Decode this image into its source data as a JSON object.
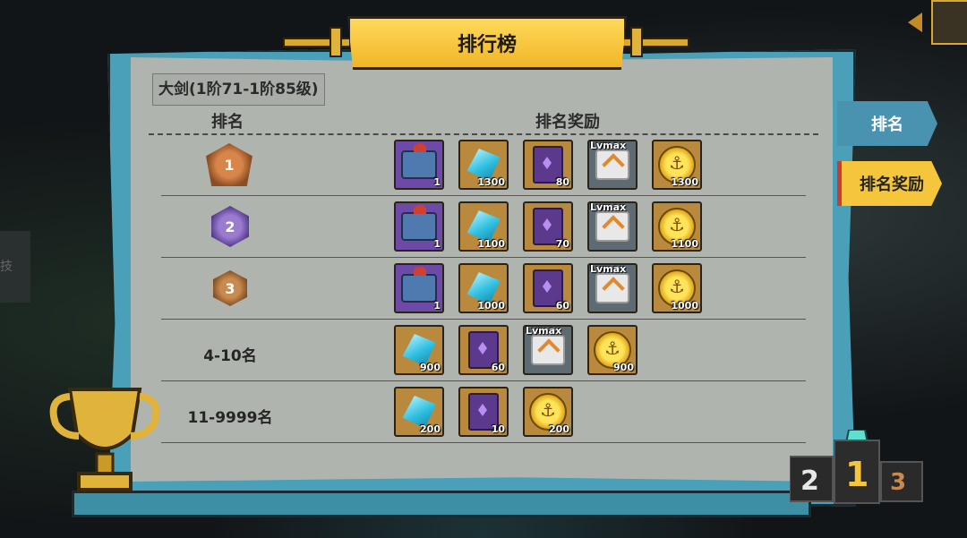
{
  "title": "排行榜",
  "subtitle": "大剑(1阶71-1阶85级)",
  "headers": {
    "rank": "排名",
    "reward": "排名奖励"
  },
  "tabs": [
    {
      "label": "排名",
      "active": false
    },
    {
      "label": "排名奖励",
      "active": true
    }
  ],
  "side_fragment": "技",
  "rows": [
    {
      "rank_label": "",
      "medal": "1",
      "medal_icon": "gold-medal-icon",
      "rewards": [
        {
          "icon": "chest-icon",
          "count": "1"
        },
        {
          "icon": "diamond-icon",
          "count": "1300"
        },
        {
          "icon": "spellbook-icon",
          "count": "80"
        },
        {
          "icon": "scroll-icon",
          "lv": "Lvmax",
          "count": ""
        },
        {
          "icon": "anchor-coin-icon",
          "count": "1300"
        }
      ]
    },
    {
      "rank_label": "",
      "medal": "2",
      "medal_icon": "silver-medal-icon",
      "rewards": [
        {
          "icon": "chest-icon",
          "count": "1"
        },
        {
          "icon": "diamond-icon",
          "count": "1100"
        },
        {
          "icon": "spellbook-icon",
          "count": "70"
        },
        {
          "icon": "scroll-icon",
          "lv": "Lvmax",
          "count": ""
        },
        {
          "icon": "anchor-coin-icon",
          "count": "1100"
        }
      ]
    },
    {
      "rank_label": "",
      "medal": "3",
      "medal_icon": "bronze-medal-icon",
      "rewards": [
        {
          "icon": "chest-icon",
          "count": "1"
        },
        {
          "icon": "diamond-icon",
          "count": "1000"
        },
        {
          "icon": "spellbook-icon",
          "count": "60"
        },
        {
          "icon": "scroll-icon",
          "lv": "Lvmax",
          "count": ""
        },
        {
          "icon": "anchor-coin-icon",
          "count": "1000"
        }
      ]
    },
    {
      "rank_label": "4-10名",
      "rewards": [
        {
          "icon": "diamond-icon",
          "count": "900"
        },
        {
          "icon": "spellbook-icon",
          "count": "60"
        },
        {
          "icon": "scroll-icon",
          "lv": "Lvmax",
          "count": ""
        },
        {
          "icon": "anchor-coin-icon",
          "count": "900"
        }
      ]
    },
    {
      "rank_label": "11-9999名",
      "rewards": [
        {
          "icon": "diamond-icon",
          "count": "200"
        },
        {
          "icon": "spellbook-icon",
          "count": "10"
        },
        {
          "icon": "anchor-coin-icon",
          "count": "200"
        }
      ]
    }
  ],
  "podium": {
    "first": "1",
    "second": "2",
    "third": "3"
  }
}
